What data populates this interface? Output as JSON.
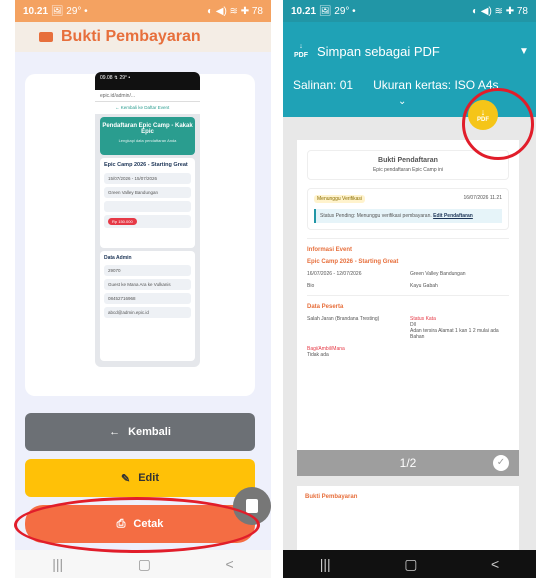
{
  "left": {
    "status_time": "10.21",
    "status_icons": "🖼 29° •",
    "status_right": "◐ ◀) ≋ ✚ 78",
    "title": "Bukti Pembayaran",
    "preview": {
      "time": "09.08 ↯ 29° •",
      "url": "epic.id/admin/...",
      "back": "← Kembali ke Daftar Event",
      "reg_title": "Pendaftaran Epic Camp - Kakak Epic",
      "reg_sub": "Lengkapi data pendaftaran Anda",
      "event_title": "Epic Camp 2026 - Starting Great",
      "date": "15/07/2026 - 15/07/2026",
      "location": "Green Valley Bandungan",
      "price": "Rp 150.000",
      "admin_title": "Data Admin",
      "admin_id": "29070",
      "admin_name": "Guest ke Mana Ara ke Vulkanis",
      "phone": "08452716968",
      "email": "abcd@admin.epic.id"
    },
    "buttons": {
      "back": "Kembali",
      "edit": "Edit",
      "print": "Cetak"
    }
  },
  "right": {
    "status_time": "10.21",
    "status_icons": "🖼 29° •",
    "status_right": "◐ ◀) ≋ ✚ 78",
    "save_as": "Simpan sebagai PDF",
    "copies_label": "Salinan:",
    "copies_value": "01",
    "paper_label": "Ukuran kertas:",
    "paper_value": "ISO A4s",
    "pdf_fab_label": "PDF",
    "doc": {
      "title": "Bukti Pendaftaran",
      "subtitle": "Epic pendaftaran Epic Camp ini",
      "status_left": "Menunggu Verifikasi",
      "status_right": "16/07/2026 11.21",
      "status_note": "Status Pending: Menunggu verifikasi pembayaran.",
      "status_link": "Edit Pendaftaran",
      "info_heading": "Informasi Event",
      "event_name": "Epic Camp 2026 - Starting Great",
      "date": "16/07/2026 - 12/07/2026",
      "location": "Green Valley Bandungan",
      "field3": "Bio",
      "field4": "Kayu Gabah",
      "peserta_heading": "Data Peserta",
      "peserta_name": "Salah Jaran (Brandana Tresting)",
      "peserta_status": "Status Kata",
      "peserta_status_val": "Dll",
      "peserta_note": "Adan tersira Alamat 1 kan 1 2 mulai ada Bahan",
      "extra_label": "Bagi/Ambil/Mana",
      "extra_val": "Tidak ada"
    },
    "pager": "1/2",
    "page2_title": "Bukti Pembayaran"
  },
  "nav": [
    "|||",
    "▢",
    "<"
  ]
}
